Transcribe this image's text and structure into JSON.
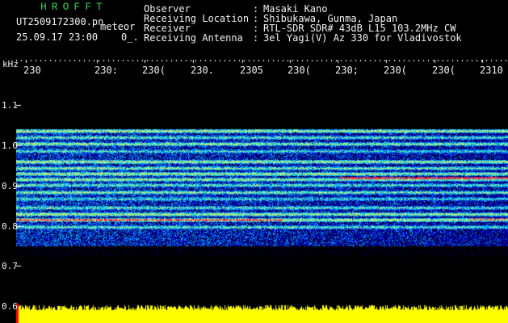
{
  "logo": "HROFFT",
  "header": {
    "filename": "UT2509172300.pn",
    "meteor": "meteor",
    "datetime": "25.09.17 23:00    0_."
  },
  "info": {
    "labels": [
      "Observer",
      "Receiving Location",
      "Receiver",
      "Receiving Antenna"
    ],
    "colons": [
      ":",
      ":",
      ":",
      ":"
    ],
    "values": [
      "Masaki Kano",
      "Shibukawa, Gunma, Japan",
      "RTL-SDR SDR# 43dB L15 103.2MHz CW",
      "3el Yagi(V) Az 330 for Vladivostok"
    ]
  },
  "axis": {
    "unit": "kHz",
    "x_ticks": [
      "230",
      "230:",
      "230(",
      "230.",
      "2305",
      "230(",
      "230;",
      "230(",
      "230(",
      "2310"
    ],
    "y_ticks": [
      "1.1",
      "1.0",
      "0.9",
      "0.8",
      "0.7",
      "0.6"
    ]
  },
  "colors": {
    "background": "#000000",
    "text": "#f2f2f2",
    "logo": "#39d353",
    "amplitude": "#ffff00",
    "marker": "#ff0000"
  }
}
